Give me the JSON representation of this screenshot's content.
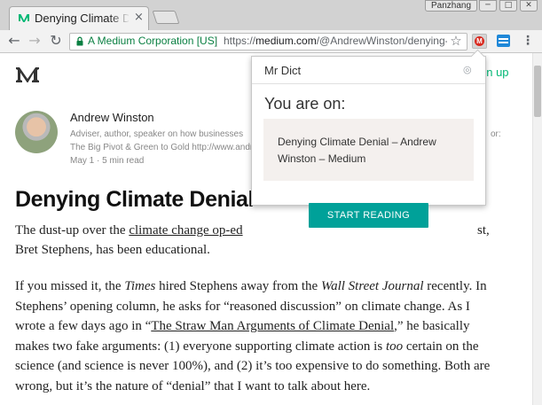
{
  "browser": {
    "tab": {
      "title": "Denying Climate Denial – Andrew Winston – Medium",
      "close_glyph": "×"
    },
    "profile_name": "Panzhang",
    "window_controls": [
      "─",
      "□",
      "✕"
    ],
    "nav": {
      "back": "←",
      "forward": "→",
      "reload": "↻"
    },
    "omnibox": {
      "site_identity": "A Medium Corporation [US]",
      "url_scheme": "https://",
      "url_host": "medium.com",
      "url_path": "/@AndrewWinston/denying-climate-denial",
      "star_glyph": "☆"
    },
    "extension_badge": "M",
    "menu_glyph": "⋮",
    "colors": {
      "secure_green": "#0b8043",
      "tab_strip": "#d2d2d2"
    }
  },
  "page": {
    "signup_label": "gn up",
    "author": {
      "name": "Andrew Winston",
      "bio_line1": "Adviser, author, speaker on how businesses",
      "bio_line1_tail": "or:",
      "bio_line2": "The Big Pivot & Green to Gold http://www.andrewwinston.com",
      "meta": "May 1 · 5 min read"
    },
    "article": {
      "title": "Denying Climate Denial",
      "p1_start": "The dust-up over the ",
      "p1_link": "climate change op-ed",
      "p1_tail": "st,",
      "p1_line2": "Bret Stephens, has been educational.",
      "p2_l1_a": "If you missed it, the ",
      "p2_l1_times": "Times",
      "p2_l1_b": " hired Stephens away from the ",
      "p2_l1_wsj": "Wall Street Journal",
      "p2_l1_c": " recently. In",
      "p2_l2": "Stephens’ opening column, he asks for “reasoned discussion” on climate change. As I",
      "p2_l3_a": "wrote a few days ago in “",
      "p2_l3_link": "The Straw Man Arguments of Climate Denial",
      "p2_l3_b": ",” he basically",
      "p2_l4_a": "makes two fake arguments: (1) everyone supporting climate action is ",
      "p2_l4_too": "too",
      "p2_l4_b": " certain on the",
      "p2_l5": "science (and science is never 100%), and (2) it’s too expensive to do something. Both are",
      "p2_l6": "wrong, but it’s the nature of “denial” that I want to talk about here."
    },
    "colors": {
      "medium_green": "#02b875"
    }
  },
  "popup": {
    "title": "Mr Dict",
    "heading": "You are on:",
    "page_title": "Denying Climate Denial – Andrew Winston – Medium",
    "button_label": "START READING",
    "colors": {
      "button": "#00a199",
      "card": "#f4f0ee"
    }
  }
}
